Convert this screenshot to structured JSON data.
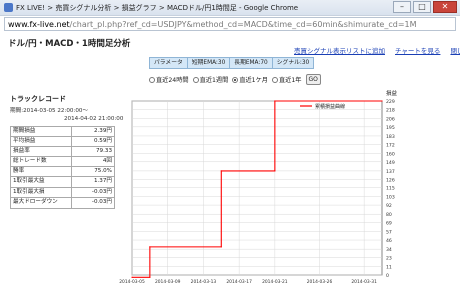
{
  "window": {
    "title": "FX LIVE! > 売買シグナル分析 > 損益グラフ > MACDドル/円1時間足 - Google Chrome",
    "buttons": [
      "–",
      "□",
      "✕"
    ]
  },
  "address": {
    "domain": "www.fx-live.net",
    "rest": "/chart_pl.php?ref_cd=USDJPY&method_cd=MACD&time_cd=60min&shimurate_cd=1M"
  },
  "page": {
    "title": "ドル/円・MACD・1時間足分析",
    "links": [
      "売買シグナル表示リストに追加",
      "チャートを見る",
      "閉じる"
    ],
    "params": [
      "パラメータ",
      "短期EMA:30",
      "長期EMA:70",
      "シグナル:30"
    ],
    "radios": [
      {
        "label": "直近24時間",
        "checked": false
      },
      {
        "label": "直近1週間",
        "checked": false
      },
      {
        "label": "直近1ケ月",
        "checked": true
      },
      {
        "label": "直近1年",
        "checked": false
      }
    ],
    "go_label": "GO",
    "track_title": "トラックレコード",
    "period_line1": "期間:2014-03-05 22:00:00～",
    "period_line2": "2014-04-02 21:00:00",
    "stats": [
      {
        "label": "期間損益",
        "value": "2.39円"
      },
      {
        "label": "平均損益",
        "value": "0.59円"
      },
      {
        "label": "損益率",
        "value": "79.33"
      },
      {
        "label": "総トレード数",
        "value": "4回"
      },
      {
        "label": "勝率",
        "value": "75.0%"
      },
      {
        "label": "1取引最大益",
        "value": "1.37円"
      },
      {
        "label": "1取引最大損",
        "value": "-0.03円"
      },
      {
        "label": "最大ドローダウン",
        "value": "-0.03円"
      }
    ]
  },
  "chart_data": {
    "type": "line",
    "ylabel": "損益",
    "legend": "累積損益曲線",
    "legend_position": "top-right",
    "y_ticks": [
      0,
      11,
      23,
      34,
      46,
      57,
      69,
      80,
      92,
      103,
      115,
      126,
      137,
      149,
      160,
      172,
      183,
      195,
      206,
      218,
      229
    ],
    "x_ticks": [
      "2014-03-05",
      "2014-03-09",
      "2014-03-13",
      "2014-03-17",
      "2014-03-21",
      "2014-03-26",
      "2014-03-31"
    ],
    "ylim": [
      0,
      229
    ],
    "xlim": [
      "2014-03-05",
      "2014-04-02"
    ],
    "grid": true,
    "series": [
      {
        "name": "累積損益曲線",
        "color": "#ff0000",
        "x": [
          "2014-03-05",
          "2014-03-07",
          "2014-03-07",
          "2014-03-15",
          "2014-03-15",
          "2014-03-21",
          "2014-03-21",
          "2014-04-02"
        ],
        "y": [
          -3,
          -3,
          37,
          37,
          137,
          137,
          229,
          229
        ]
      }
    ]
  }
}
